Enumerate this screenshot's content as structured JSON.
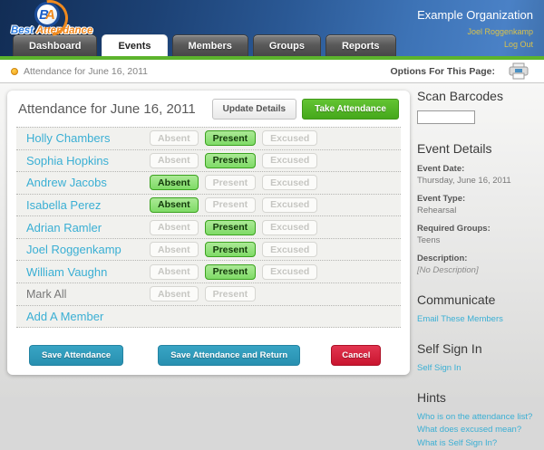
{
  "colors": {
    "accent_green": "#5cb42c",
    "link_cyan": "#3aafd4",
    "selected_green": "#7edb66",
    "take_attendance_green": "#45a81b",
    "save_teal": "#2890b0",
    "cancel_red": "#c9152f",
    "header_gold": "#d9c24d"
  },
  "header": {
    "logo": {
      "badge_b": "B",
      "badge_a": "A",
      "word1": "Best",
      "word2": "Attendance"
    },
    "org_name": "Example Organization",
    "user_name": "Joel Roggenkamp",
    "logout_label": "Log Out",
    "tabs": [
      {
        "label": "Dashboard"
      },
      {
        "label": "Events"
      },
      {
        "label": "Members"
      },
      {
        "label": "Groups"
      },
      {
        "label": "Reports"
      }
    ]
  },
  "breadcrumb": {
    "label": "Attendance for June 16, 2011",
    "options_label": "Options For This Page:",
    "printer_icon": "printer-icon"
  },
  "main": {
    "title": "Attendance for June 16, 2011",
    "update_details_label": "Update Details",
    "take_attendance_label": "Take Attendance",
    "status_options": [
      "Absent",
      "Present",
      "Excused"
    ],
    "rows": [
      {
        "name": "Holly Chambers",
        "type": "member",
        "selected": "Present"
      },
      {
        "name": "Sophia Hopkins",
        "type": "member",
        "selected": "Present"
      },
      {
        "name": "Andrew Jacobs",
        "type": "member",
        "selected": "Absent"
      },
      {
        "name": "Isabella Perez",
        "type": "member",
        "selected": "Absent"
      },
      {
        "name": "Adrian Ramler",
        "type": "member",
        "selected": "Present"
      },
      {
        "name": "Joel Roggenkamp",
        "type": "member",
        "selected": "Present"
      },
      {
        "name": "William Vaughn",
        "type": "member",
        "selected": "Present"
      },
      {
        "name": "Mark All",
        "type": "markall",
        "selected": null,
        "options": [
          "Absent",
          "Present"
        ]
      },
      {
        "name": "Add A Member",
        "type": "add",
        "selected": null,
        "options": []
      }
    ],
    "actions": {
      "save": "Save Attendance",
      "save_return": "Save Attendance and Return",
      "cancel": "Cancel"
    }
  },
  "sidebar": {
    "scan": {
      "title": "Scan Barcodes",
      "input_value": ""
    },
    "event_details": {
      "title": "Event Details",
      "fields": [
        {
          "label": "Event Date:",
          "value": "Thursday, June 16, 2011"
        },
        {
          "label": "Event Type:",
          "value": "Rehearsal"
        },
        {
          "label": "Required Groups:",
          "value": "Teens"
        },
        {
          "label": "Description:",
          "value": "[No Description]"
        }
      ]
    },
    "communicate": {
      "title": "Communicate",
      "link": "Email These Members"
    },
    "self_sign_in": {
      "title": "Self Sign In",
      "link": "Self Sign In"
    },
    "hints": {
      "title": "Hints",
      "links": [
        "Who is on the attendance list?",
        "What does excused mean?",
        "What is Self Sign In?"
      ]
    }
  }
}
